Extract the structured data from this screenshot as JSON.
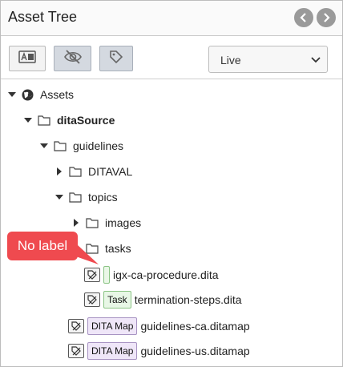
{
  "panel": {
    "title": "Asset Tree",
    "nav_prev_icon": "chevron-left-icon",
    "nav_next_icon": "chevron-right-icon"
  },
  "toolbar": {
    "buttons": [
      {
        "name": "text-label-toggle",
        "icon": "text-label-icon"
      },
      {
        "name": "hide-toggle",
        "icon": "eye-slash-icon",
        "active": true
      },
      {
        "name": "tag-toggle",
        "icon": "tag-icon"
      }
    ],
    "mode_select": {
      "value": "Live"
    }
  },
  "tree": {
    "root": "Assets",
    "ditasource": "ditaSource",
    "guidelines": "guidelines",
    "ditaval": "DITAVAL",
    "topics": "topics",
    "images": "images",
    "tasks": "tasks",
    "files": [
      {
        "badge": "",
        "name": "igx-ca-procedure.dita"
      },
      {
        "badge": "Task",
        "name": "termination-steps.dita"
      },
      {
        "badge": "DITA Map",
        "name": "guidelines-ca.ditamap"
      },
      {
        "badge": "DITA Map",
        "name": "guidelines-us.ditamap"
      }
    ]
  },
  "callout": {
    "text": "No label"
  },
  "colors": {
    "callout": "#ef4a4f",
    "task_badge": "#e8f7e6",
    "map_badge": "#efe6f8"
  }
}
